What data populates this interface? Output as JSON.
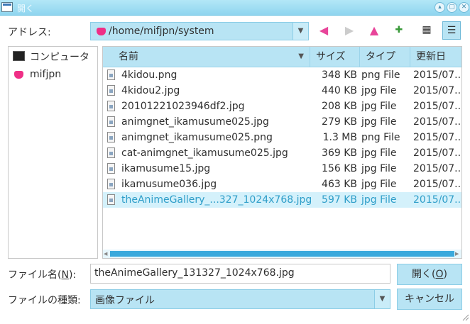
{
  "window": {
    "title": "開く"
  },
  "address": {
    "label": "アドレス:",
    "path": "/home/mifjpn/system"
  },
  "places": [
    {
      "label": "コンピュータ",
      "icon": "computer-icon"
    },
    {
      "label": "mifjpn",
      "icon": "home-folder-icon"
    }
  ],
  "columns": {
    "name": "名前",
    "size": "サイズ",
    "type": "タイプ",
    "modified": "更新日"
  },
  "files": [
    {
      "name": "4kidou.png",
      "size": "348 KB",
      "type": "png File",
      "modified": "2015/07..."
    },
    {
      "name": "4kidou2.jpg",
      "size": "440 KB",
      "type": "jpg File",
      "modified": "2015/07..."
    },
    {
      "name": "20101221023946df2.jpg",
      "size": "208 KB",
      "type": "jpg File",
      "modified": "2015/07..."
    },
    {
      "name": "animgnet_ikamusume025.jpg",
      "size": "279 KB",
      "type": "jpg File",
      "modified": "2015/07..."
    },
    {
      "name": "animgnet_ikamusume025.png",
      "size": "1.3 MB",
      "type": "png File",
      "modified": "2015/07..."
    },
    {
      "name": "cat-animgnet_ikamusume025.jpg",
      "size": "369 KB",
      "type": "jpg File",
      "modified": "2015/07..."
    },
    {
      "name": "ikamusume15.jpg",
      "size": "156 KB",
      "type": "jpg File",
      "modified": "2015/07..."
    },
    {
      "name": "ikamusume036.jpg",
      "size": "463 KB",
      "type": "jpg File",
      "modified": "2015/07..."
    },
    {
      "name": "theAnimeGallery_...327_1024x768.jpg",
      "size": "597 KB",
      "type": "jpg File",
      "modified": "2015/07...",
      "selected": true
    }
  ],
  "filename": {
    "label_pre": "ファイル名(",
    "label_key": "N",
    "label_post": "):",
    "value": "theAnimeGallery_131327_1024x768.jpg"
  },
  "filetype": {
    "label": "ファイルの種類:",
    "value": "画像ファイル"
  },
  "buttons": {
    "open_pre": "開く(",
    "open_key": "O",
    "open_post": ")",
    "cancel": "キャンセル"
  },
  "colors": {
    "accent": "#b8e4f4",
    "selection_text": "#2f9ec9",
    "scroll_thumb": "#3aa9dc",
    "bookmark": "#ef2f86"
  }
}
